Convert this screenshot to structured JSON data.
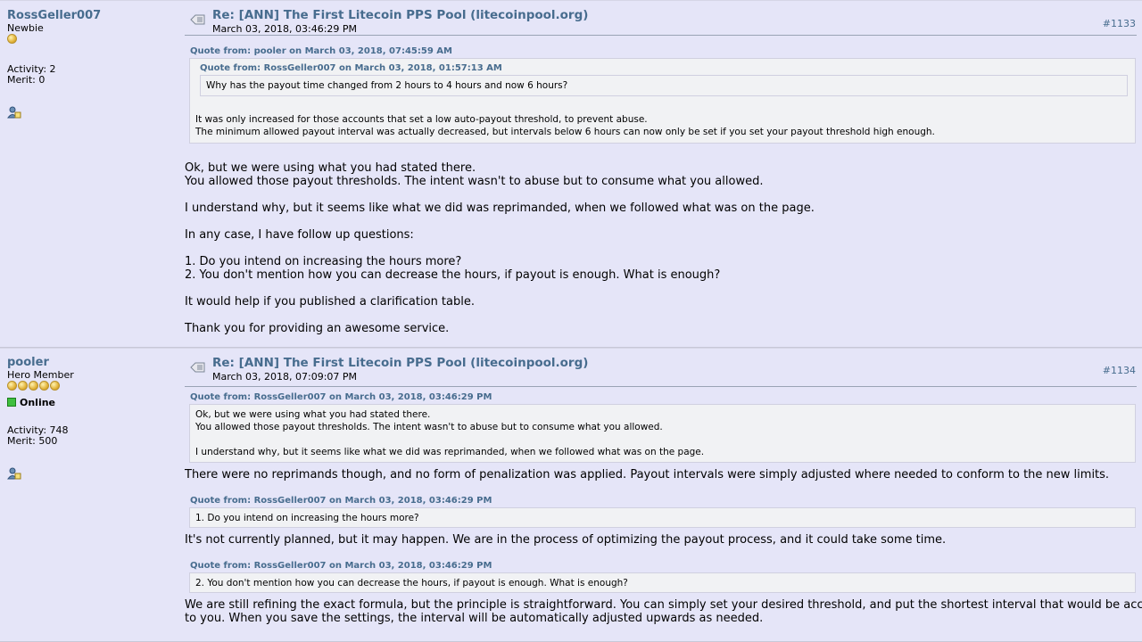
{
  "posts": [
    {
      "user": {
        "name": "RossGeller007",
        "rank": "Newbie",
        "coins": 1,
        "activity": "Activity: 2",
        "merit": "Merit: 0"
      },
      "subject": "Re: [ANN] The First Litecoin PPS Pool (litecoinpool.org)",
      "date": "March 03, 2018, 03:46:29 PM",
      "number": "#1133",
      "outer_quote": {
        "header": "Quote from: pooler on March 03, 2018, 07:45:59 AM",
        "inner_header": "Quote from: RossGeller007 on March 03, 2018, 01:57:13 AM",
        "inner_text": "Why has the payout time changed from 2 hours to 4 hours and now 6 hours?",
        "lines": [
          "It was only increased for those accounts that set a low auto-payout threshold, to prevent abuse.",
          "The minimum allowed payout interval was actually decreased, but intervals below 6 hours can now only be set if you set your payout threshold high enough."
        ]
      },
      "body": [
        "Ok, but we were using what you had stated there.",
        "You allowed those payout thresholds. The intent wasn't to abuse but to consume what you allowed.",
        "I understand why, but it seems like what we did was reprimanded, when we followed what was on the page.",
        "In any case, I have follow up questions:",
        "1. Do you intend on increasing the hours more?",
        "2. You don't mention how you can decrease the hours, if payout is enough. What is enough?",
        "It would help if you published a clarification table.",
        "Thank you for providing an awesome service."
      ]
    },
    {
      "user": {
        "name": "pooler",
        "rank": "Hero Member",
        "coins": 5,
        "status": "Online",
        "activity": "Activity: 748",
        "merit": "Merit: 500"
      },
      "subject": "Re: [ANN] The First Litecoin PPS Pool (litecoinpool.org)",
      "date": "March 03, 2018, 07:09:07 PM",
      "number": "#1134",
      "quote1": {
        "header": "Quote from: RossGeller007 on March 03, 2018, 03:46:29 PM",
        "lines": [
          "Ok, but we were using what you had stated there.",
          "You allowed those payout thresholds. The intent wasn't to abuse but to consume what you allowed.",
          "I understand why, but it seems like what we did was reprimanded, when we followed what was on the page."
        ]
      },
      "reply1": "There were no reprimands though, and no form of penalization was applied. Payout intervals were simply adjusted where needed to conform to the new limits.",
      "quote2": {
        "header": "Quote from: RossGeller007 on March 03, 2018, 03:46:29 PM",
        "text": "1. Do you intend on increasing the hours more?"
      },
      "reply2": "It's not currently planned, but it may happen. We are in the process of optimizing the payout process, and it could take some time.",
      "quote3": {
        "header": "Quote from: RossGeller007 on March 03, 2018, 03:46:29 PM",
        "text": "2. You don't mention how you can decrease the hours, if payout is enough. What is enough?"
      },
      "reply3": [
        "We are still refining the exact formula, but the principle is straightforward. You can simply set your desired threshold, and put the shortest interval that would be acceptable",
        "to you. When you save the settings, the interval will be automatically adjusted upwards as needed."
      ]
    }
  ],
  "icons": {
    "topic": "topic-message-icon",
    "profile": "user-profile-icon"
  },
  "colors": {
    "background": "#e5e5f8",
    "link": "#476c8e",
    "quote_bg": "#f1f2f4"
  }
}
